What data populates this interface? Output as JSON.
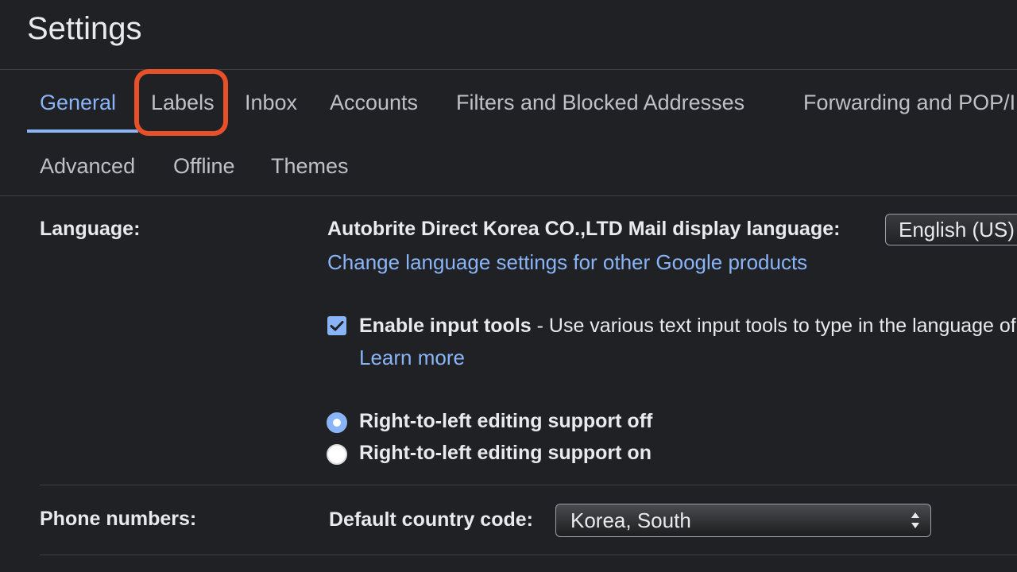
{
  "header": {
    "title": "Settings"
  },
  "tabs_row1": [
    {
      "label": "General",
      "active": true
    },
    {
      "label": "Labels",
      "highlighted": true
    },
    {
      "label": "Inbox"
    },
    {
      "label": "Accounts"
    },
    {
      "label": "Filters and Blocked Addresses"
    },
    {
      "label": "Forwarding and POP/IMAP"
    }
  ],
  "tabs_row2": [
    {
      "label": "Advanced"
    },
    {
      "label": "Offline"
    },
    {
      "label": "Themes"
    }
  ],
  "language": {
    "label": "Language:",
    "display_language_label": "Autobrite Direct Korea CO.,LTD Mail display language:",
    "display_language_value": "English (US)",
    "change_link": "Change language settings for other Google products",
    "input_tools_bold": "Enable input tools",
    "input_tools_desc": " - Use various text input tools to type in the language of your choice",
    "input_tools_checked": true,
    "learn_more": "Learn more",
    "rtl_off": "Right-to-left editing support off",
    "rtl_on": "Right-to-left editing support on",
    "rtl_selected": "off"
  },
  "phone": {
    "label": "Phone numbers:",
    "country_code_label": "Default country code:",
    "country_code_value": "Korea, South"
  },
  "colors": {
    "background": "#202124",
    "accent": "#8ab4f8",
    "highlight": "#e8502a"
  }
}
